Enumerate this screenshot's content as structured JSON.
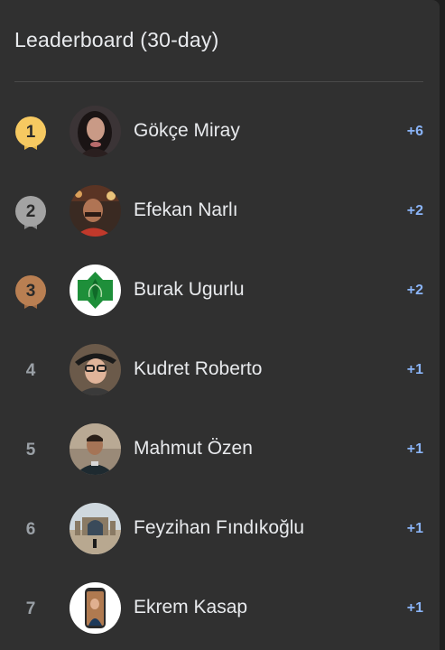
{
  "header": {
    "title": "Leaderboard (30-day)"
  },
  "colors": {
    "gold": "#f6c961",
    "silver": "#9e9e9e",
    "bronze": "#b97f52",
    "score": "#8ab4f8"
  },
  "entries": [
    {
      "rank": "1",
      "name": "Gökçe Miray",
      "score": "+6",
      "medal": "gold"
    },
    {
      "rank": "2",
      "name": "Efekan Narlı",
      "score": "+2",
      "medal": "silver"
    },
    {
      "rank": "3",
      "name": "Burak Ugurlu",
      "score": "+2",
      "medal": "bronze"
    },
    {
      "rank": "4",
      "name": "Kudret Roberto",
      "score": "+1",
      "medal": ""
    },
    {
      "rank": "5",
      "name": "Mahmut Özen",
      "score": "+1",
      "medal": ""
    },
    {
      "rank": "6",
      "name": "Feyzihan Fındıkoğlu",
      "score": "+1",
      "medal": ""
    },
    {
      "rank": "7",
      "name": "Ekrem Kasap",
      "score": "+1",
      "medal": ""
    }
  ]
}
